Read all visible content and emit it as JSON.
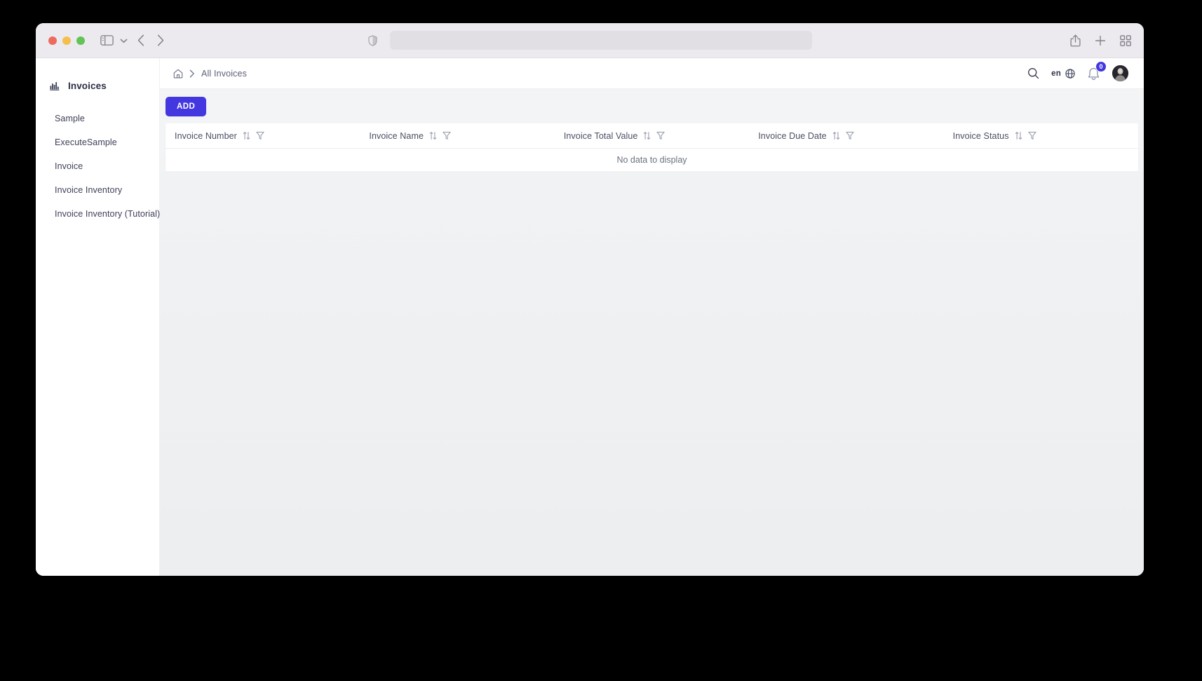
{
  "browser": {
    "traffic_lights": [
      "close",
      "minimize",
      "maximize"
    ],
    "sidebar_toggle_icon": "sidebar-toggle-icon",
    "tab_menu_icon": "chevron-down-icon",
    "back_icon": "chevron-left-icon",
    "forward_icon": "chevron-right-icon",
    "shield_icon": "shield-icon",
    "address_bar_value": "",
    "address_bar_placeholder": "",
    "share_icon": "share-icon",
    "new_tab_icon": "plus-icon",
    "tab_overview_icon": "grid-icon"
  },
  "sidebar": {
    "brand_icon": "bar-chart-icon",
    "brand_label": "Invoices",
    "items": [
      {
        "label": "Sample"
      },
      {
        "label": "ExecuteSample"
      },
      {
        "label": "Invoice"
      },
      {
        "label": "Invoice Inventory"
      },
      {
        "label": "Invoice Inventory (Tutorial)"
      }
    ]
  },
  "header": {
    "home_icon": "home-icon",
    "separator": "›",
    "breadcrumb_current": "All Invoices",
    "search_icon": "search-icon",
    "language_label": "en",
    "globe_icon": "globe-icon",
    "bell_icon": "bell-icon",
    "notification_count": "0",
    "avatar_icon": "avatar"
  },
  "toolbar": {
    "add_label": "ADD"
  },
  "table": {
    "sort_icon": "sort-icon",
    "filter_icon": "filter-icon",
    "columns": [
      {
        "label": "Invoice Number"
      },
      {
        "label": "Invoice Name"
      },
      {
        "label": "Invoice Total Value"
      },
      {
        "label": "Invoice Due Date"
      },
      {
        "label": "Invoice Status"
      }
    ],
    "rows": [],
    "empty_message": "No data to display"
  },
  "colors": {
    "accent": "#4338e0",
    "page_bg": "#f1f2f4",
    "chrome_bg": "#eceaee",
    "card_bg": "#ffffff",
    "text_primary": "#2c2f45",
    "text_muted": "#6b7280"
  }
}
